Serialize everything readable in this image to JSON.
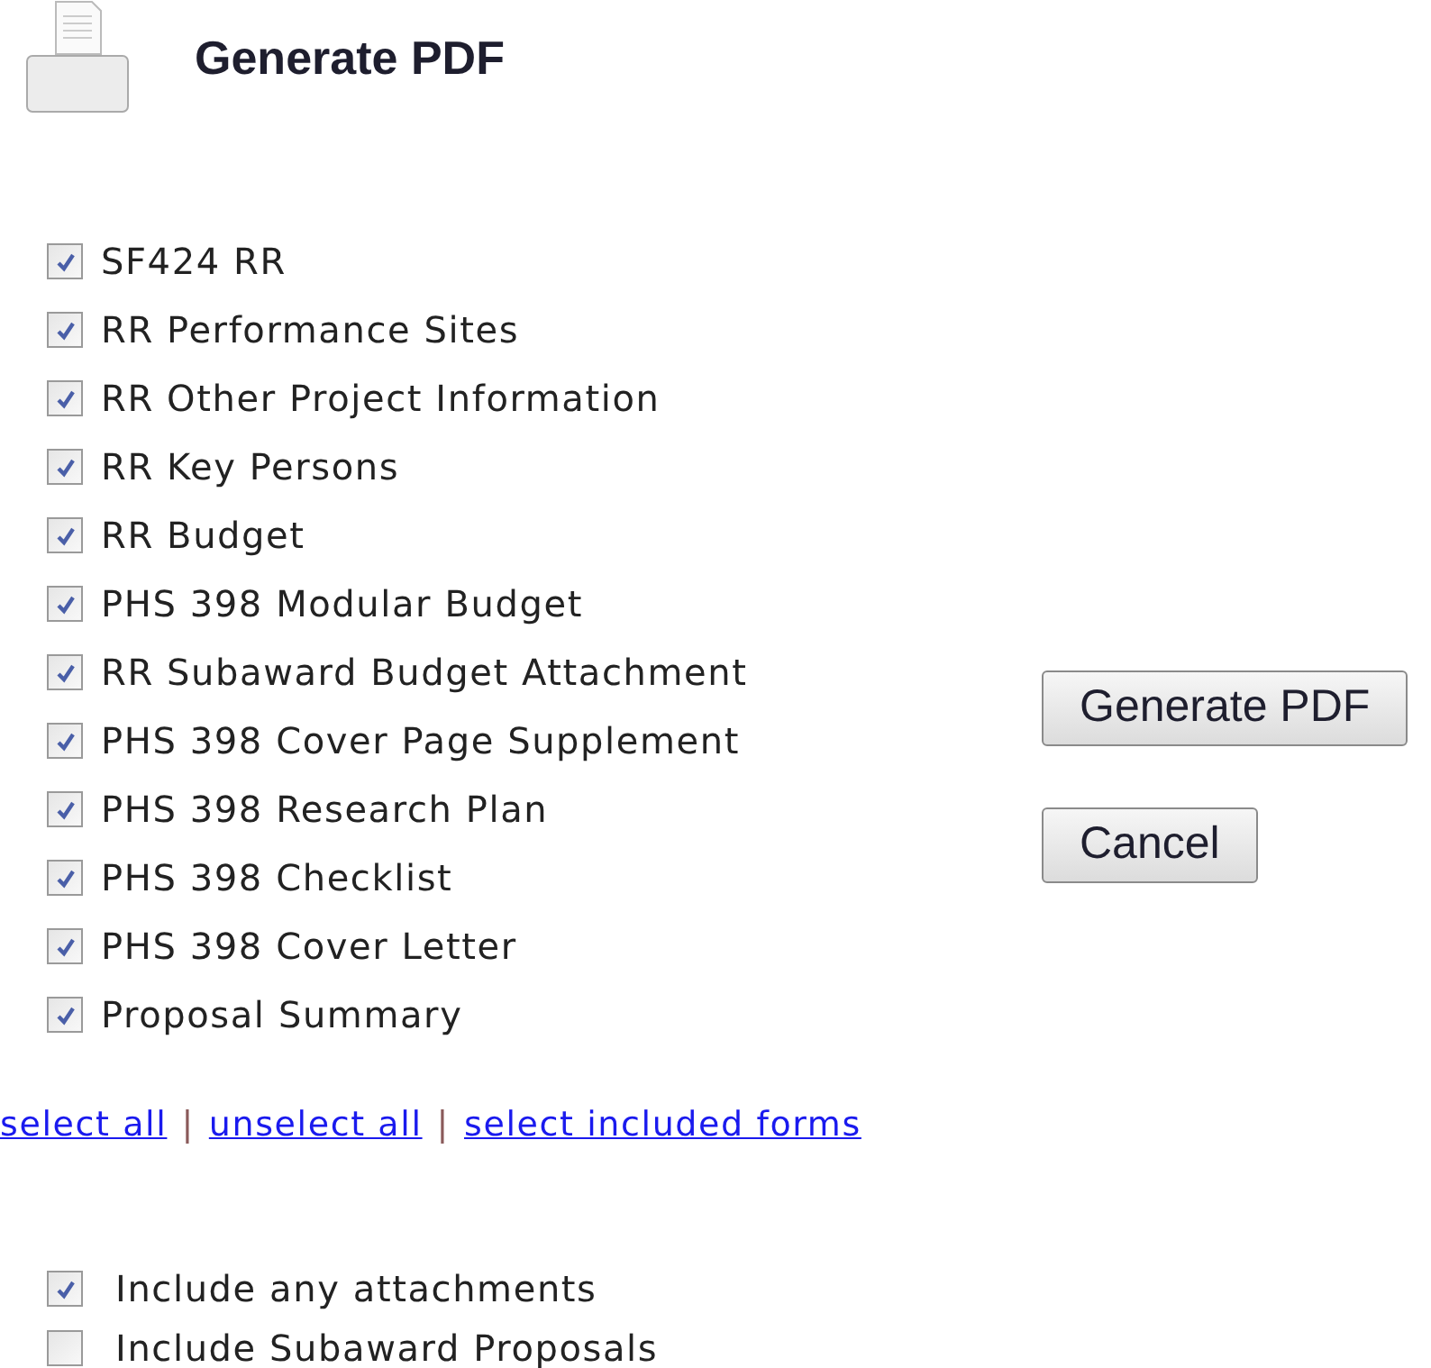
{
  "header": {
    "title": "Generate PDF"
  },
  "forms": [
    {
      "label": "SF424 RR",
      "checked": true
    },
    {
      "label": "RR Performance Sites",
      "checked": true
    },
    {
      "label": "RR Other Project Information",
      "checked": true
    },
    {
      "label": "RR Key Persons",
      "checked": true
    },
    {
      "label": "RR Budget",
      "checked": true
    },
    {
      "label": "PHS 398 Modular Budget",
      "checked": true
    },
    {
      "label": "RR Subaward Budget Attachment",
      "checked": true
    },
    {
      "label": "PHS 398 Cover Page Supplement",
      "checked": true
    },
    {
      "label": "PHS 398 Research Plan",
      "checked": true
    },
    {
      "label": "PHS 398 Checklist",
      "checked": true
    },
    {
      "label": "PHS 398 Cover Letter",
      "checked": true
    },
    {
      "label": "Proposal Summary",
      "checked": true
    }
  ],
  "buttons": [
    "Generate PDF",
    "Cancel"
  ],
  "links": [
    {
      "label": "select all"
    },
    {
      "label": "|",
      "kind": "separator"
    },
    {
      "label": "unselect all"
    },
    {
      "label": "|",
      "kind": "separator"
    },
    {
      "label": "select included forms"
    }
  ],
  "options": [
    {
      "label": "Include any attachments",
      "checked": true
    },
    {
      "label": "Include Subaward Proposals",
      "checked": false
    }
  ]
}
